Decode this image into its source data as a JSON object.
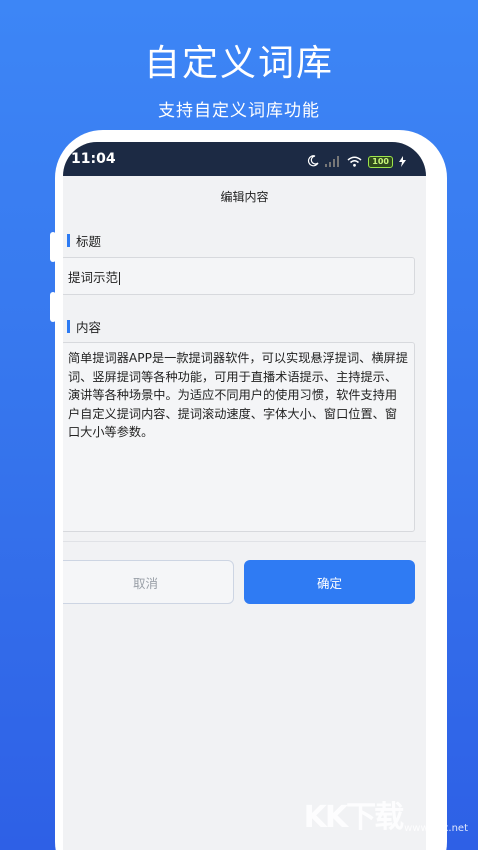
{
  "promo": {
    "title": "自定义词库",
    "subtitle": "支持自定义词库功能"
  },
  "status_bar": {
    "time": "11:04",
    "battery": "100"
  },
  "header": {
    "title": "编辑内容"
  },
  "form": {
    "title_label": "标题",
    "title_value": "提词示范",
    "content_label": "内容",
    "content_value": "简单提词器APP是一款提词器软件，可以实现悬浮提词、横屏提词、竖屏提词等各种功能，可用于直播术语提示、主持提示、演讲等各种场景中。为适应不同用户的使用习惯，软件支持用户自定义提词内容、提词滚动速度、字体大小、窗口位置、窗口大小等参数。"
  },
  "buttons": {
    "cancel": "取消",
    "confirm": "确定"
  },
  "watermark": {
    "logo": "KK下载",
    "url": "www.kkx.net"
  },
  "colors": {
    "background": "#3573ec",
    "status_bar": "#1c2a44",
    "accent": "#2f7bf3"
  }
}
